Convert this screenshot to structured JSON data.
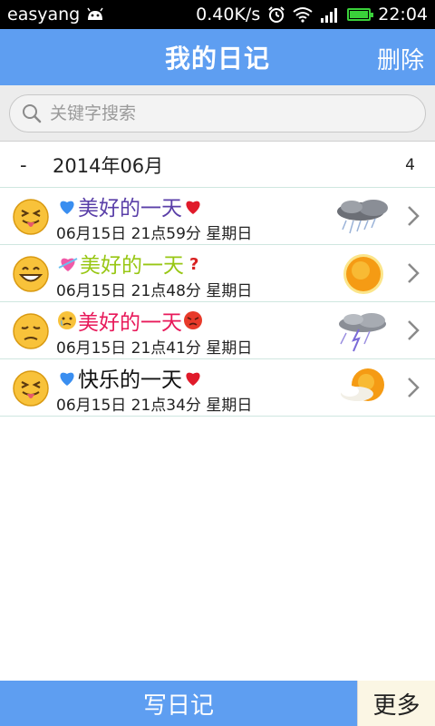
{
  "status_bar": {
    "carrier": "easyang",
    "speed": "0.40K/s",
    "time": "22:04",
    "battery_level": 1.0,
    "icons": [
      "android-icon",
      "alarm-icon",
      "wifi-icon",
      "signal-icon",
      "battery-icon"
    ]
  },
  "header": {
    "title": "我的日记",
    "delete_label": "删除"
  },
  "search": {
    "placeholder": "关键字搜索",
    "value": ""
  },
  "group": {
    "toggle": "-",
    "label": "2014年06月",
    "count": "4"
  },
  "entries": [
    {
      "title": "美好的一天",
      "title_color": "#5a3fa8",
      "pre_icon": "blue-heart-icon",
      "post_icon": "red-heart-icon",
      "date": "06月15日 21点59分 星期日",
      "mood": "tongue-out-face-icon",
      "weather": "rain-cloud-icon"
    },
    {
      "title": "美好的一天",
      "title_color": "#98c714",
      "pre_icon": "heart-with-ribbon-icon",
      "post_icon": "question-mark-icon",
      "date": "06月15日 21点48分 星期日",
      "mood": "grinning-face-icon",
      "weather": "sun-icon"
    },
    {
      "title": "美好的一天",
      "title_color": "#e8195a",
      "pre_icon": "crying-face-icon",
      "post_icon": "angry-face-icon",
      "date": "06月15日 21点41分 星期日",
      "mood": "pensive-face-icon",
      "weather": "thunderstorm-cloud-icon"
    },
    {
      "title": "快乐的一天",
      "title_color": "#111111",
      "pre_icon": "blue-heart-icon",
      "post_icon": "red-heart-icon",
      "date": "06月15日 21点34分 星期日",
      "mood": "tongue-out-face-icon",
      "weather": "sun-behind-cloud-icon"
    }
  ],
  "bottom_bar": {
    "write_label": "写日记",
    "more_label": "更多"
  },
  "colors": {
    "accent": "#5e9ef1",
    "more_bg": "#fbf6e4"
  }
}
